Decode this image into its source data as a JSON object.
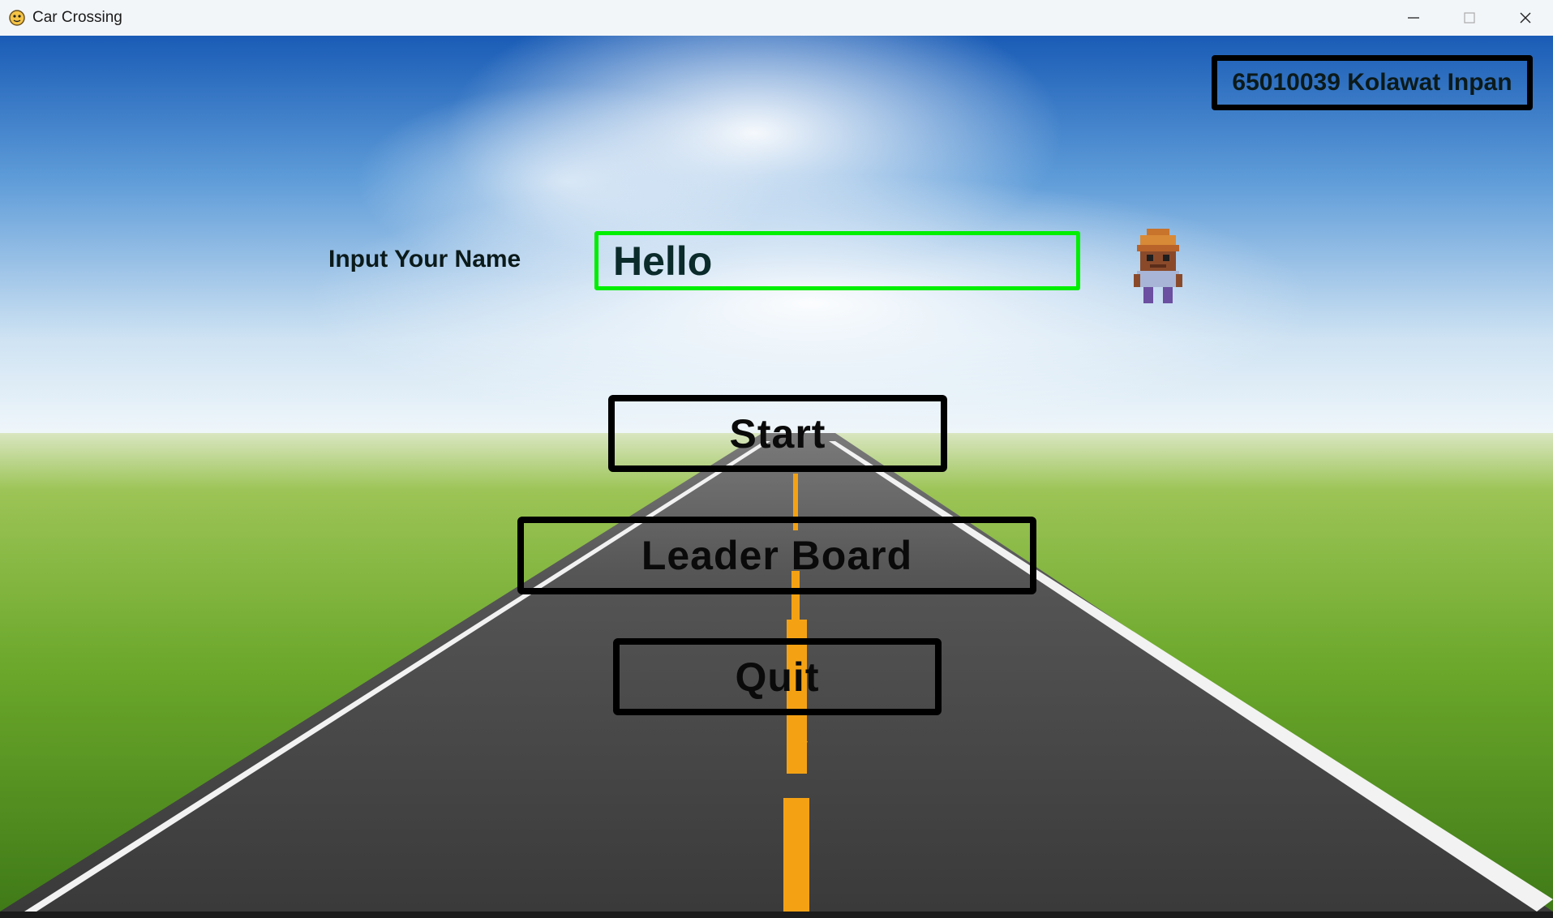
{
  "window": {
    "title": "Car Crossing",
    "app_icon": "python-snake-icon",
    "controls": [
      "minimize-icon",
      "maximize-icon",
      "close-icon"
    ]
  },
  "game": {
    "student_id_label": "65010039 Kolawat Inpan",
    "name_prompt": "Input Your Name",
    "name_value": "Hello",
    "buttons": {
      "start": "Start",
      "leaderboard": "Leader Board",
      "quit": "Quit"
    },
    "colors": {
      "input_border": "#00ee00",
      "sky_top": "#1f5fb8",
      "grass": "#6fae2a",
      "road": "#3d3d3d",
      "center_line": "#f4a214"
    }
  }
}
